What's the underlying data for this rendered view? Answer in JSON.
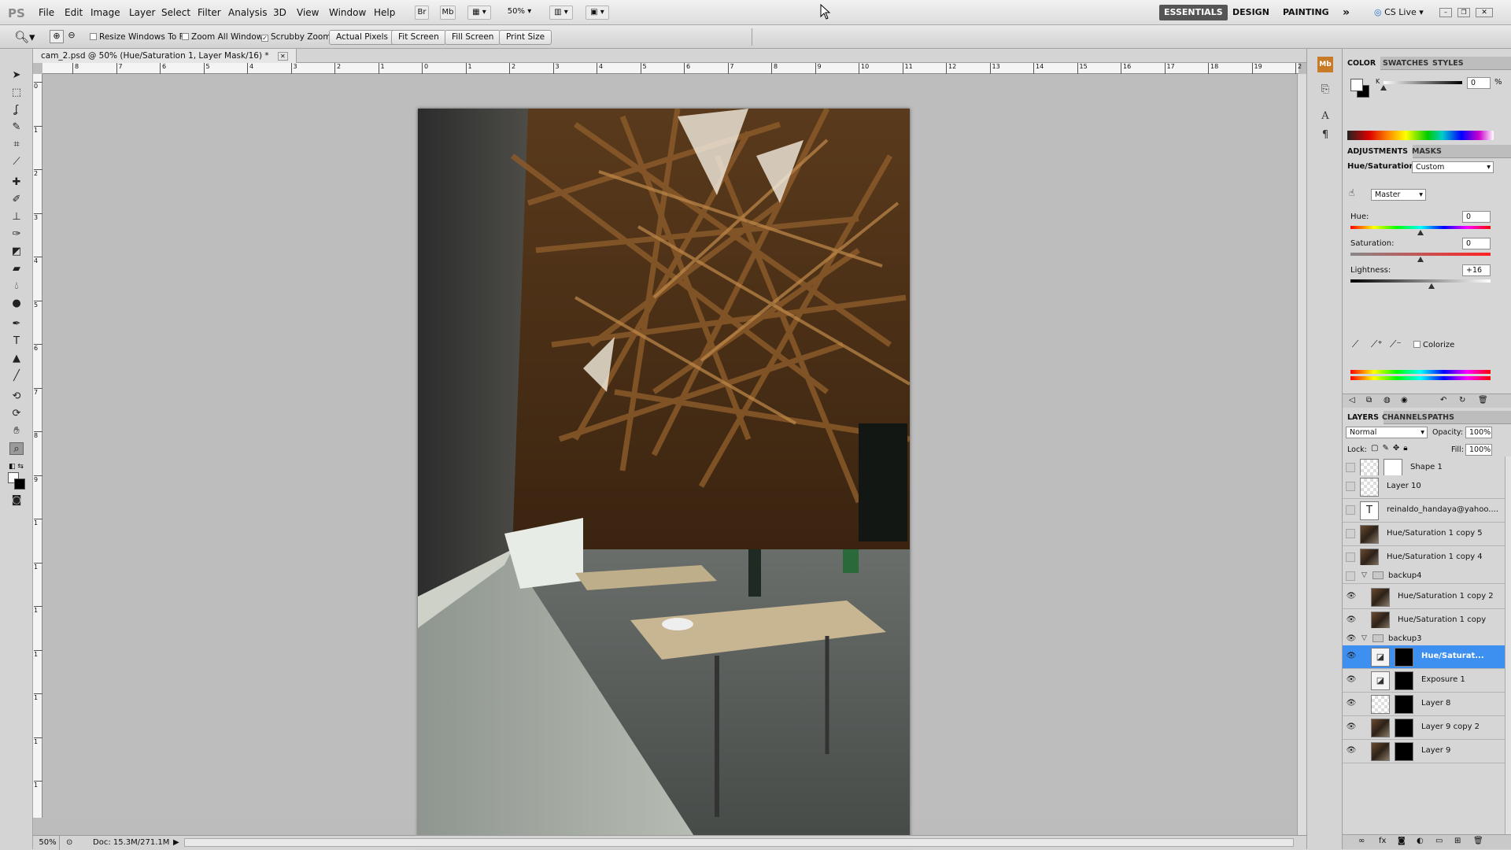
{
  "app": {
    "logo": "PS",
    "doc_tab": "cam_2.psd @ 50% (Hue/Saturation 1, Layer Mask/16) *"
  },
  "menus": [
    "File",
    "Edit",
    "Image",
    "Layer",
    "Select",
    "Filter",
    "Analysis",
    "3D",
    "View",
    "Window",
    "Help"
  ],
  "menubar": {
    "br_label": "Br",
    "mb_label": "Mb",
    "zoom": "50%",
    "workspaces": [
      "ESSENTIALS",
      "DESIGN",
      "PAINTING"
    ],
    "more": "»",
    "cslive": "CS Live"
  },
  "options": {
    "resize_windows": "Resize Windows To Fit",
    "zoom_all": "Zoom All Windows",
    "scrubby": "Scrubby Zoom",
    "actual_pixels": "Actual Pixels",
    "fit_screen": "Fit Screen",
    "fill_screen": "Fill Screen",
    "print_size": "Print Size"
  },
  "status": {
    "zoom": "50%",
    "doc": "Doc: 15.3M/271.1M"
  },
  "ruler": {
    "h": [
      "8",
      "7",
      "6",
      "5",
      "4",
      "3",
      "2",
      "1",
      "0",
      "1",
      "2",
      "3",
      "4",
      "5",
      "6",
      "7",
      "8",
      "9",
      "10",
      "11",
      "12",
      "13",
      "14",
      "15",
      "16",
      "17",
      "18",
      "19",
      "2"
    ],
    "v": [
      "0",
      "1",
      "2",
      "3",
      "4",
      "5",
      "6",
      "7",
      "8",
      "9",
      "1",
      "1",
      "1",
      "1",
      "1",
      "1",
      "1"
    ]
  },
  "color_panel": {
    "tabs": [
      "COLOR",
      "SWATCHES",
      "STYLES"
    ],
    "k_label": "K",
    "k_value": "0",
    "unit": "%",
    "k_level": 0
  },
  "adjustments": {
    "tabs": [
      "ADJUSTMENTS",
      "MASKS"
    ],
    "title": "Hue/Saturation",
    "preset": "Custom",
    "channel": "Master",
    "hue_label": "Hue:",
    "hue": "0",
    "sat_label": "Saturation:",
    "sat": "0",
    "light_label": "Lightness:",
    "light": "+16",
    "colorize": "Colorize"
  },
  "layers_panel": {
    "tabs": [
      "LAYERS",
      "CHANNELS",
      "PATHS"
    ],
    "blend": "Normal",
    "opacity_label": "Opacity:",
    "opacity": "100%",
    "lock_label": "Lock:",
    "fill_label": "Fill:",
    "fill": "100%",
    "layers": [
      {
        "name": "Shape 1",
        "visible": false,
        "kind": "shape"
      },
      {
        "name": "Layer 10",
        "visible": false,
        "kind": "empty"
      },
      {
        "name": "reinaldo_handaya@yahoo....",
        "visible": false,
        "kind": "text",
        "glyph": "T"
      },
      {
        "name": "Hue/Saturation 1 copy 5",
        "visible": false,
        "kind": "photo"
      },
      {
        "name": "Hue/Saturation 1 copy 4",
        "visible": false,
        "kind": "photo"
      },
      {
        "name": "backup4",
        "visible": false,
        "kind": "group"
      },
      {
        "name": "Hue/Saturation 1 copy 2",
        "visible": true,
        "kind": "photo"
      },
      {
        "name": "Hue/Saturation 1 copy",
        "visible": true,
        "kind": "photo"
      },
      {
        "name": "backup3",
        "visible": true,
        "kind": "group"
      },
      {
        "name": "Hue/Saturat...",
        "visible": true,
        "kind": "adjust",
        "selected": true
      },
      {
        "name": "Exposure 1",
        "visible": true,
        "kind": "adjust"
      },
      {
        "name": "Layer 8",
        "visible": true,
        "kind": "mask"
      },
      {
        "name": "Layer 9 copy 2",
        "visible": true,
        "kind": "photo"
      },
      {
        "name": "Layer 9",
        "visible": true,
        "kind": "photo"
      }
    ]
  },
  "colors": {
    "accent": "#3d8ff0",
    "ws_active": "#555555"
  }
}
